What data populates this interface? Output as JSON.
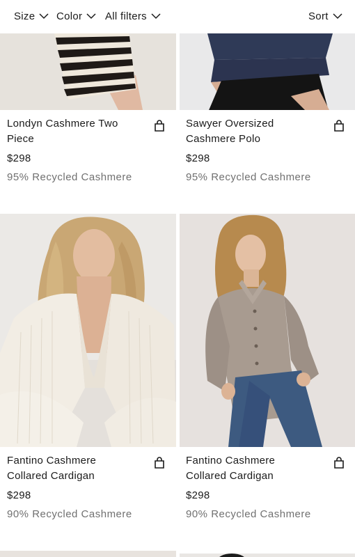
{
  "filters": {
    "size_label": "Size",
    "color_label": "Color",
    "all_filters_label": "All filters",
    "sort_label": "Sort"
  },
  "products": [
    {
      "name_line1": "Londyn Cashmere Two",
      "name_line2": "Piece",
      "price": "$298",
      "material": "95% Recycled Cashmere"
    },
    {
      "name_line1": "Sawyer Oversized",
      "name_line2": "Cashmere Polo",
      "price": "$298",
      "material": "95% Recycled Cashmere"
    },
    {
      "name_line1": "Fantino Cashmere",
      "name_line2": "Collared Cardigan",
      "price": "$298",
      "material": "90% Recycled Cashmere"
    },
    {
      "name_line1": "Fantino Cashmere",
      "name_line2": "Collared Cardigan",
      "price": "$298",
      "material": "90% Recycled Cashmere"
    }
  ],
  "colors": {
    "text": "#1a1a1a",
    "muted": "#707070",
    "background": "#ffffff"
  }
}
